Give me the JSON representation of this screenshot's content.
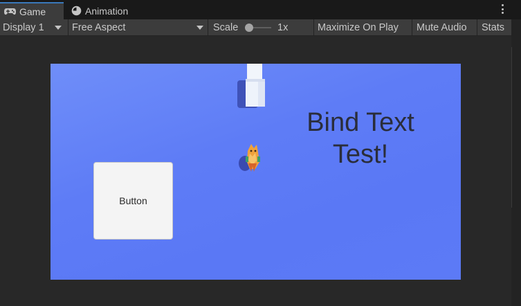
{
  "tabs": [
    {
      "label": "Game",
      "icon": "gamepad-icon",
      "active": true
    },
    {
      "label": "Animation",
      "icon": "animation-clock-icon",
      "active": false
    }
  ],
  "toolbar": {
    "display": "Display 1",
    "aspect": "Free Aspect",
    "scale_label": "Scale",
    "scale_value": "1x",
    "maximize_on_play": "Maximize On Play",
    "mute_audio": "Mute Audio",
    "stats": "Stats"
  },
  "game": {
    "button_label": "Button",
    "bind_text_line1": "Bind Text",
    "bind_text_line2": "Test!"
  },
  "colors": {
    "game_background": "#5e7cf6",
    "active_tab_accent": "#3a79bb",
    "panel": "#282828",
    "toolbar": "#3c3c3c"
  }
}
